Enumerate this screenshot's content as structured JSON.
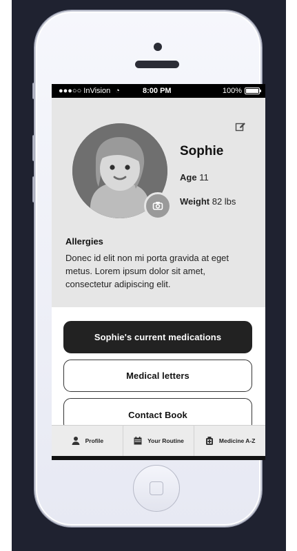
{
  "status_bar": {
    "carrier": "●●●○○ InVision",
    "time": "8:00 PM",
    "battery": "100%",
    "battery_level": 1.0
  },
  "profile": {
    "name": "Sophie",
    "age_label": "Age",
    "age_value": "11",
    "weight_label": "Weight",
    "weight_value": "82 lbs",
    "allergies_title": "Allergies",
    "allergies_text": "Donec id elit non mi porta gravida at eget metus. Lorem ipsum dolor sit amet, consectetur adipiscing elit."
  },
  "actions": {
    "current_medications": "Sophie's current medications",
    "medical_letters": "Medical letters",
    "contact_book": "Contact Book"
  },
  "tab_bar": {
    "items": [
      {
        "label": "Profile",
        "icon": "person-icon"
      },
      {
        "label": "Your Routine",
        "icon": "calendar-icon"
      },
      {
        "label": "Medicine A-Z",
        "icon": "medicine-icon"
      }
    ]
  },
  "colors": {
    "background": "#1f2230",
    "panel": "#e6e6e6",
    "primary_button": "#222222",
    "tab_bar": "#ececec"
  }
}
